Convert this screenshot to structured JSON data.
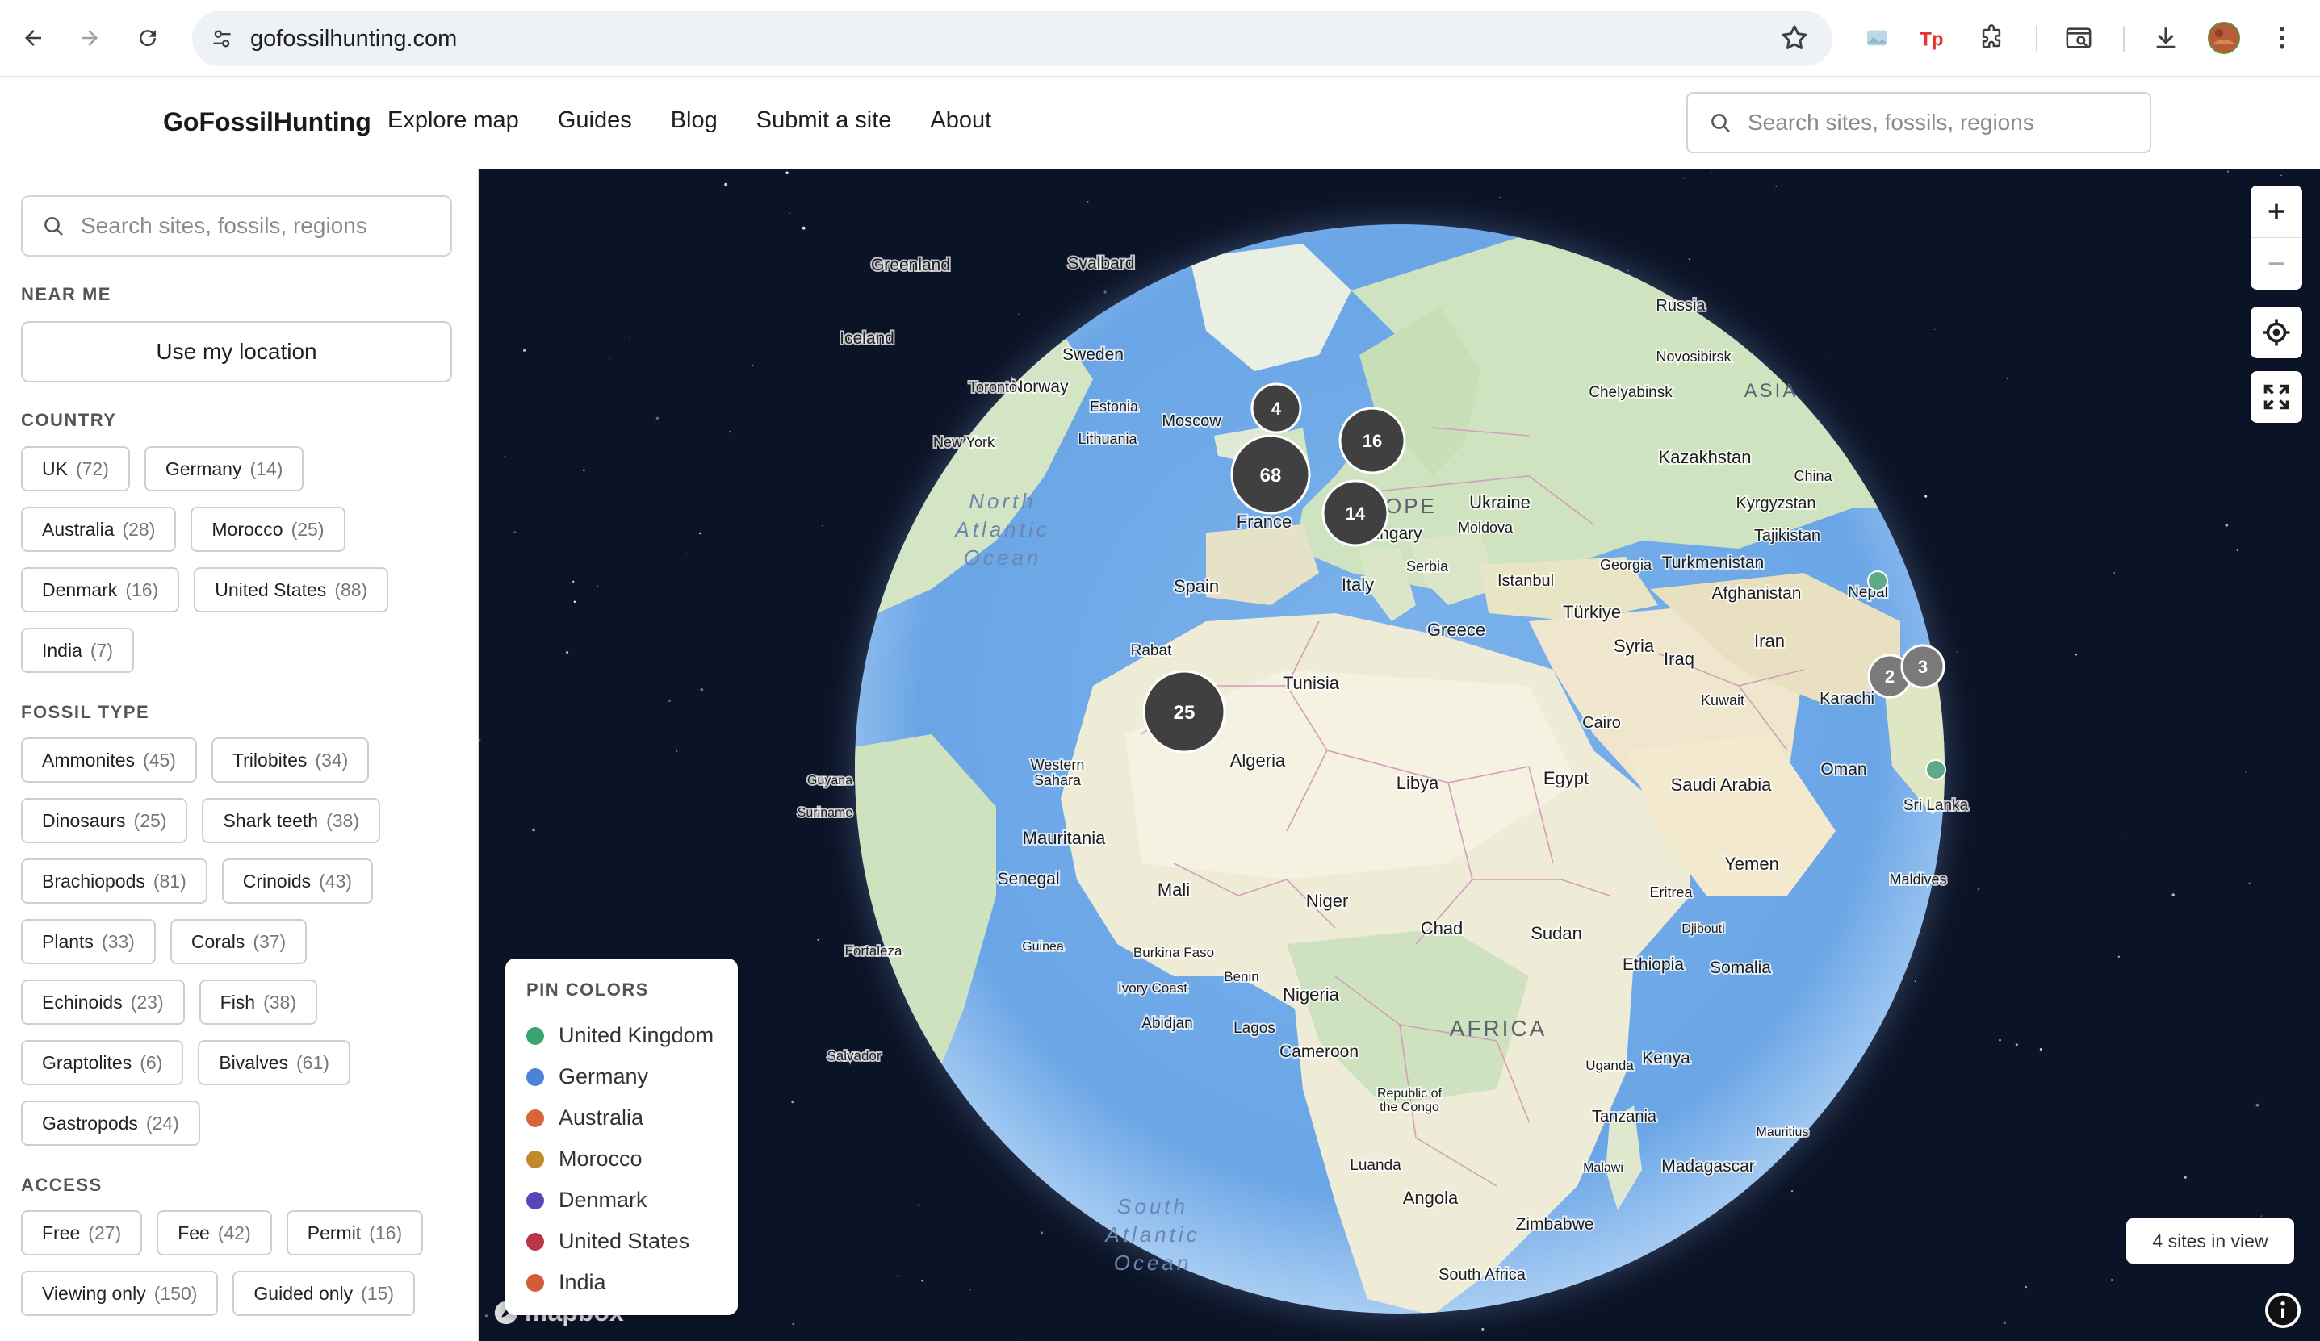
{
  "browser": {
    "url": "gofossilhunting.com",
    "nav": [
      "back-icon",
      "forward-icon",
      "reload-icon"
    ],
    "extensions": [
      "extension-image-icon",
      "tp-extension-icon",
      "puzzle-extensions-icon",
      "tab-search-icon",
      "download-icon",
      "profile-avatar",
      "kebab-menu-icon"
    ]
  },
  "site": {
    "logo": "GoFossilHunting",
    "nav": [
      "Explore map",
      "Guides",
      "Blog",
      "Submit a site",
      "About"
    ],
    "search_placeholder": "Search sites, fossils, regions"
  },
  "sidebar": {
    "search_placeholder": "Search sites, fossils, regions",
    "near_me": {
      "title": "NEAR ME",
      "button": "Use my location"
    },
    "country": {
      "title": "COUNTRY",
      "chips": [
        {
          "label": "UK",
          "count": "(72)"
        },
        {
          "label": "Germany",
          "count": "(14)"
        },
        {
          "label": "Australia",
          "count": "(28)"
        },
        {
          "label": "Morocco",
          "count": "(25)"
        },
        {
          "label": "Denmark",
          "count": "(16)"
        },
        {
          "label": "United States",
          "count": "(88)"
        },
        {
          "label": "India",
          "count": "(7)"
        }
      ]
    },
    "fossil_type": {
      "title": "FOSSIL TYPE",
      "chips": [
        {
          "label": "Ammonites",
          "count": "(45)"
        },
        {
          "label": "Trilobites",
          "count": "(34)"
        },
        {
          "label": "Dinosaurs",
          "count": "(25)"
        },
        {
          "label": "Shark teeth",
          "count": "(38)"
        },
        {
          "label": "Brachiopods",
          "count": "(81)"
        },
        {
          "label": "Crinoids",
          "count": "(43)"
        },
        {
          "label": "Plants",
          "count": "(33)"
        },
        {
          "label": "Corals",
          "count": "(37)"
        },
        {
          "label": "Echinoids",
          "count": "(23)"
        },
        {
          "label": "Fish",
          "count": "(38)"
        },
        {
          "label": "Graptolites",
          "count": "(6)"
        },
        {
          "label": "Bivalves",
          "count": "(61)"
        },
        {
          "label": "Gastropods",
          "count": "(24)"
        }
      ]
    },
    "access": {
      "title": "ACCESS",
      "chips": [
        {
          "label": "Free",
          "count": "(27)"
        },
        {
          "label": "Fee",
          "count": "(42)"
        },
        {
          "label": "Permit",
          "count": "(16)"
        },
        {
          "label": "Viewing only",
          "count": "(150)"
        },
        {
          "label": "Guided only",
          "count": "(15)"
        }
      ]
    }
  },
  "map": {
    "clusters": [
      "4",
      "68",
      "16",
      "14",
      "25",
      "2",
      "3"
    ],
    "labels": {
      "greenland": "Greenland",
      "svalbard": "Svalbard",
      "russia": "Russia",
      "iceland": "Iceland",
      "sweden": "Sweden",
      "norway": "Norway",
      "novosibirsk": "Novosibirsk",
      "asia": "ASIA",
      "estonia": "Estonia",
      "chelyabinsk": "Chelyabinsk",
      "lithuania": "Lithuania",
      "moscow": "Moscow",
      "kazakhstan": "Kazakhstan",
      "toronto": "Toronto",
      "new_york": "New York",
      "china": "China",
      "europe": "EUROPE",
      "ukraine": "Ukraine",
      "kyrgyzstan": "Kyrgyzstan",
      "france": "France",
      "moldova": "Moldova",
      "tajikistan": "Tajikistan",
      "hungary": "Hungary",
      "serbia": "Serbia",
      "georgia": "Georgia",
      "turkmenistan": "Turkmenistan",
      "spain": "Spain",
      "italy": "Italy",
      "istanbul": "Istanbul",
      "afghanistan": "Afghanistan",
      "nepal": "Nepal",
      "turkiye": "Türkiye",
      "greece": "Greece",
      "rabat": "Rabat",
      "syria": "Syria",
      "iraq": "Iraq",
      "iran": "Iran",
      "tunisia": "Tunisia",
      "kuwait": "Kuwait",
      "karachi": "Karachi",
      "cairo": "Cairo",
      "guyana": "Guyana",
      "western_sahara": "Western\nSahara",
      "algeria": "Algeria",
      "libya": "Libya",
      "egypt": "Egypt",
      "saudi_arabia": "Saudi Arabia",
      "oman": "Oman",
      "suriname": "Suriname",
      "sri_lanka": "Sri Lanka",
      "mauritania": "Mauritania",
      "yemen": "Yemen",
      "senegal": "Senegal",
      "mali": "Mali",
      "niger": "Niger",
      "eritrea": "Eritrea",
      "maldives": "Maldives",
      "chad": "Chad",
      "sudan": "Sudan",
      "djibouti": "Djibouti",
      "guinea": "Guinea",
      "fortaleza": "Fortaleza",
      "burkina_faso": "Burkina Faso",
      "benin": "Benin",
      "ethiopia": "Ethiopia",
      "somalia": "Somalia",
      "ivory_coast": "Ivory Coast",
      "nigeria": "Nigeria",
      "abidjan": "Abidjan",
      "lagos": "Lagos",
      "salvador": "Salvador",
      "africa": "AFRICA",
      "cameroon": "Cameroon",
      "uganda": "Uganda",
      "kenya": "Kenya",
      "republic_congo": "Republic of\nthe Congo",
      "tanzania": "Tanzania",
      "mauritius": "Mauritius",
      "luanda": "Luanda",
      "malawi": "Malawi",
      "madagascar": "Madagascar",
      "angola": "Angola",
      "zimbabwe": "Zimbabwe",
      "south_africa": "South Africa",
      "north_atlantic": "North\nAtlantic\nOcean",
      "south_atlantic": "South\nAtlantic\nOcean"
    },
    "legend": {
      "title": "PIN COLORS",
      "items": [
        {
          "label": "United Kingdom",
          "color": "#3aa36e"
        },
        {
          "label": "Germany",
          "color": "#4a84d9"
        },
        {
          "label": "Australia",
          "color": "#d9643a"
        },
        {
          "label": "Morocco",
          "color": "#c08a2c"
        },
        {
          "label": "Denmark",
          "color": "#5845b8"
        },
        {
          "label": "United States",
          "color": "#b8354a"
        },
        {
          "label": "India",
          "color": "#d35b35"
        }
      ]
    },
    "sites_in_view": "4 sites in view",
    "attribution": "mapbox"
  }
}
